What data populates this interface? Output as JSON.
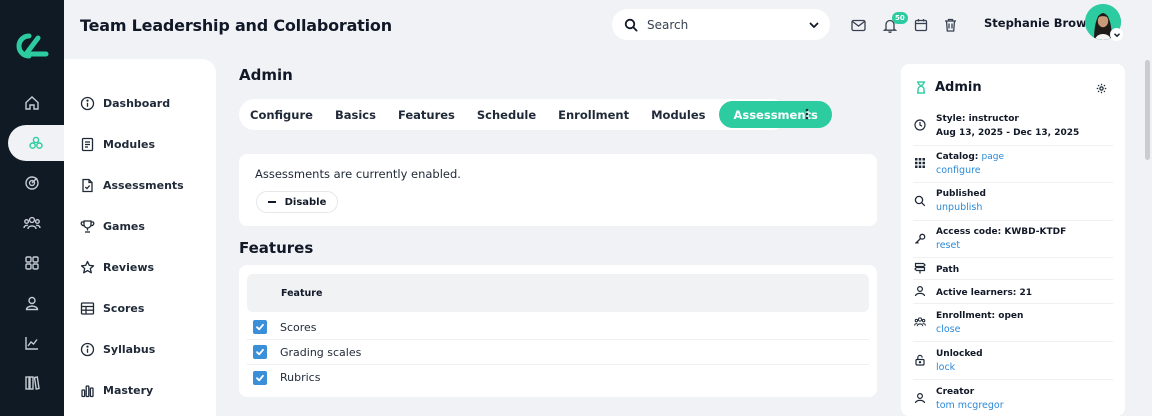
{
  "header": {
    "title": "Team Leadership and Collaboration",
    "search_placeholder": "Search",
    "notification_count": "50",
    "user_name": "Stephanie Brown"
  },
  "rail": {
    "items": [
      "home-icon",
      "modules-cluster-icon",
      "target-icon",
      "people-icon",
      "grid-icon",
      "user-icon",
      "chart-icon",
      "library-icon"
    ]
  },
  "sidenav": {
    "items": [
      {
        "label": "Dashboard",
        "icon": "info-icon"
      },
      {
        "label": "Modules",
        "icon": "notebook-icon"
      },
      {
        "label": "Assessments",
        "icon": "file-check-icon"
      },
      {
        "label": "Games",
        "icon": "trophy-icon"
      },
      {
        "label": "Reviews",
        "icon": "star-icon"
      },
      {
        "label": "Scores",
        "icon": "table-icon"
      },
      {
        "label": "Syllabus",
        "icon": "info-icon"
      },
      {
        "label": "Mastery",
        "icon": "bar-chart-icon"
      }
    ]
  },
  "main": {
    "section_title": "Admin",
    "tabs": [
      {
        "label": "Configure"
      },
      {
        "label": "Basics"
      },
      {
        "label": "Features"
      },
      {
        "label": "Schedule"
      },
      {
        "label": "Enrollment"
      },
      {
        "label": "Modules"
      },
      {
        "label": "Assessments",
        "active": true
      }
    ],
    "status_text": "Assessments are currently enabled.",
    "disable_label": "Disable",
    "features_title": "Features",
    "features_table": {
      "header": "Feature",
      "rows": [
        {
          "label": "Scores",
          "checked": true
        },
        {
          "label": "Grading scales",
          "checked": true
        },
        {
          "label": "Rubrics",
          "checked": true
        }
      ]
    }
  },
  "right_panel": {
    "title": "Admin",
    "items": [
      {
        "label": "Style: instructor",
        "sub": "Aug 13, 2025 - Dec 13, 2025",
        "icon": "clock-icon"
      },
      {
        "label": "Catalog:",
        "label_link": "page",
        "sub": "configure",
        "icon": "grid-dots-icon"
      },
      {
        "label": "Published",
        "sub": "unpublish",
        "icon": "search-icon"
      },
      {
        "label": "Access code: KWBD-KTDF",
        "sub": "reset",
        "icon": "key-icon"
      },
      {
        "label": "Path",
        "icon": "signpost-icon"
      },
      {
        "label": "Active learners: 21",
        "icon": "user-icon"
      },
      {
        "label": "Enrollment: open",
        "sub": "close",
        "icon": "group-icon"
      },
      {
        "label": "Unlocked",
        "sub": "lock",
        "icon": "unlock-icon"
      },
      {
        "label": "Creator",
        "sub": "tom mcgregor",
        "icon": "user-icon"
      }
    ]
  },
  "colors": {
    "accent": "#2ccca0",
    "rail_bg": "#0f1a24",
    "link": "#2b8ad8",
    "checkbox": "#3b8fd9",
    "page_bg": "#f0f2f5"
  }
}
